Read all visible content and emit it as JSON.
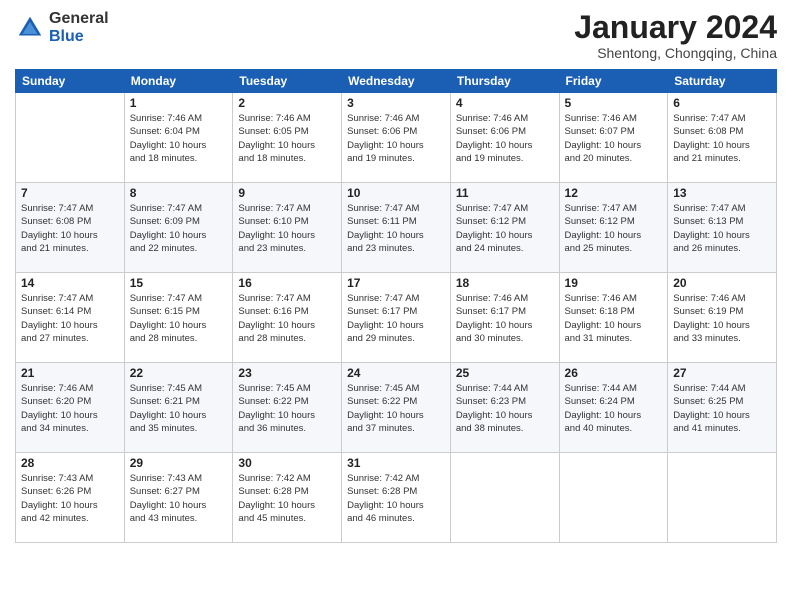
{
  "header": {
    "logo": {
      "general": "General",
      "blue": "Blue"
    },
    "title": "January 2024",
    "location": "Shentong, Chongqing, China"
  },
  "weekdays": [
    "Sunday",
    "Monday",
    "Tuesday",
    "Wednesday",
    "Thursday",
    "Friday",
    "Saturday"
  ],
  "weeks": [
    [
      {
        "day": "",
        "sunrise": "",
        "sunset": "",
        "daylight": ""
      },
      {
        "day": "1",
        "sunrise": "Sunrise: 7:46 AM",
        "sunset": "Sunset: 6:04 PM",
        "daylight": "Daylight: 10 hours and 18 minutes."
      },
      {
        "day": "2",
        "sunrise": "Sunrise: 7:46 AM",
        "sunset": "Sunset: 6:05 PM",
        "daylight": "Daylight: 10 hours and 18 minutes."
      },
      {
        "day": "3",
        "sunrise": "Sunrise: 7:46 AM",
        "sunset": "Sunset: 6:06 PM",
        "daylight": "Daylight: 10 hours and 19 minutes."
      },
      {
        "day": "4",
        "sunrise": "Sunrise: 7:46 AM",
        "sunset": "Sunset: 6:06 PM",
        "daylight": "Daylight: 10 hours and 19 minutes."
      },
      {
        "day": "5",
        "sunrise": "Sunrise: 7:46 AM",
        "sunset": "Sunset: 6:07 PM",
        "daylight": "Daylight: 10 hours and 20 minutes."
      },
      {
        "day": "6",
        "sunrise": "Sunrise: 7:47 AM",
        "sunset": "Sunset: 6:08 PM",
        "daylight": "Daylight: 10 hours and 21 minutes."
      }
    ],
    [
      {
        "day": "7",
        "sunrise": "Sunrise: 7:47 AM",
        "sunset": "Sunset: 6:08 PM",
        "daylight": "Daylight: 10 hours and 21 minutes."
      },
      {
        "day": "8",
        "sunrise": "Sunrise: 7:47 AM",
        "sunset": "Sunset: 6:09 PM",
        "daylight": "Daylight: 10 hours and 22 minutes."
      },
      {
        "day": "9",
        "sunrise": "Sunrise: 7:47 AM",
        "sunset": "Sunset: 6:10 PM",
        "daylight": "Daylight: 10 hours and 23 minutes."
      },
      {
        "day": "10",
        "sunrise": "Sunrise: 7:47 AM",
        "sunset": "Sunset: 6:11 PM",
        "daylight": "Daylight: 10 hours and 23 minutes."
      },
      {
        "day": "11",
        "sunrise": "Sunrise: 7:47 AM",
        "sunset": "Sunset: 6:12 PM",
        "daylight": "Daylight: 10 hours and 24 minutes."
      },
      {
        "day": "12",
        "sunrise": "Sunrise: 7:47 AM",
        "sunset": "Sunset: 6:12 PM",
        "daylight": "Daylight: 10 hours and 25 minutes."
      },
      {
        "day": "13",
        "sunrise": "Sunrise: 7:47 AM",
        "sunset": "Sunset: 6:13 PM",
        "daylight": "Daylight: 10 hours and 26 minutes."
      }
    ],
    [
      {
        "day": "14",
        "sunrise": "Sunrise: 7:47 AM",
        "sunset": "Sunset: 6:14 PM",
        "daylight": "Daylight: 10 hours and 27 minutes."
      },
      {
        "day": "15",
        "sunrise": "Sunrise: 7:47 AM",
        "sunset": "Sunset: 6:15 PM",
        "daylight": "Daylight: 10 hours and 28 minutes."
      },
      {
        "day": "16",
        "sunrise": "Sunrise: 7:47 AM",
        "sunset": "Sunset: 6:16 PM",
        "daylight": "Daylight: 10 hours and 28 minutes."
      },
      {
        "day": "17",
        "sunrise": "Sunrise: 7:47 AM",
        "sunset": "Sunset: 6:17 PM",
        "daylight": "Daylight: 10 hours and 29 minutes."
      },
      {
        "day": "18",
        "sunrise": "Sunrise: 7:46 AM",
        "sunset": "Sunset: 6:17 PM",
        "daylight": "Daylight: 10 hours and 30 minutes."
      },
      {
        "day": "19",
        "sunrise": "Sunrise: 7:46 AM",
        "sunset": "Sunset: 6:18 PM",
        "daylight": "Daylight: 10 hours and 31 minutes."
      },
      {
        "day": "20",
        "sunrise": "Sunrise: 7:46 AM",
        "sunset": "Sunset: 6:19 PM",
        "daylight": "Daylight: 10 hours and 33 minutes."
      }
    ],
    [
      {
        "day": "21",
        "sunrise": "Sunrise: 7:46 AM",
        "sunset": "Sunset: 6:20 PM",
        "daylight": "Daylight: 10 hours and 34 minutes."
      },
      {
        "day": "22",
        "sunrise": "Sunrise: 7:45 AM",
        "sunset": "Sunset: 6:21 PM",
        "daylight": "Daylight: 10 hours and 35 minutes."
      },
      {
        "day": "23",
        "sunrise": "Sunrise: 7:45 AM",
        "sunset": "Sunset: 6:22 PM",
        "daylight": "Daylight: 10 hours and 36 minutes."
      },
      {
        "day": "24",
        "sunrise": "Sunrise: 7:45 AM",
        "sunset": "Sunset: 6:22 PM",
        "daylight": "Daylight: 10 hours and 37 minutes."
      },
      {
        "day": "25",
        "sunrise": "Sunrise: 7:44 AM",
        "sunset": "Sunset: 6:23 PM",
        "daylight": "Daylight: 10 hours and 38 minutes."
      },
      {
        "day": "26",
        "sunrise": "Sunrise: 7:44 AM",
        "sunset": "Sunset: 6:24 PM",
        "daylight": "Daylight: 10 hours and 40 minutes."
      },
      {
        "day": "27",
        "sunrise": "Sunrise: 7:44 AM",
        "sunset": "Sunset: 6:25 PM",
        "daylight": "Daylight: 10 hours and 41 minutes."
      }
    ],
    [
      {
        "day": "28",
        "sunrise": "Sunrise: 7:43 AM",
        "sunset": "Sunset: 6:26 PM",
        "daylight": "Daylight: 10 hours and 42 minutes."
      },
      {
        "day": "29",
        "sunrise": "Sunrise: 7:43 AM",
        "sunset": "Sunset: 6:27 PM",
        "daylight": "Daylight: 10 hours and 43 minutes."
      },
      {
        "day": "30",
        "sunrise": "Sunrise: 7:42 AM",
        "sunset": "Sunset: 6:28 PM",
        "daylight": "Daylight: 10 hours and 45 minutes."
      },
      {
        "day": "31",
        "sunrise": "Sunrise: 7:42 AM",
        "sunset": "Sunset: 6:28 PM",
        "daylight": "Daylight: 10 hours and 46 minutes."
      },
      {
        "day": "",
        "sunrise": "",
        "sunset": "",
        "daylight": ""
      },
      {
        "day": "",
        "sunrise": "",
        "sunset": "",
        "daylight": ""
      },
      {
        "day": "",
        "sunrise": "",
        "sunset": "",
        "daylight": ""
      }
    ]
  ]
}
